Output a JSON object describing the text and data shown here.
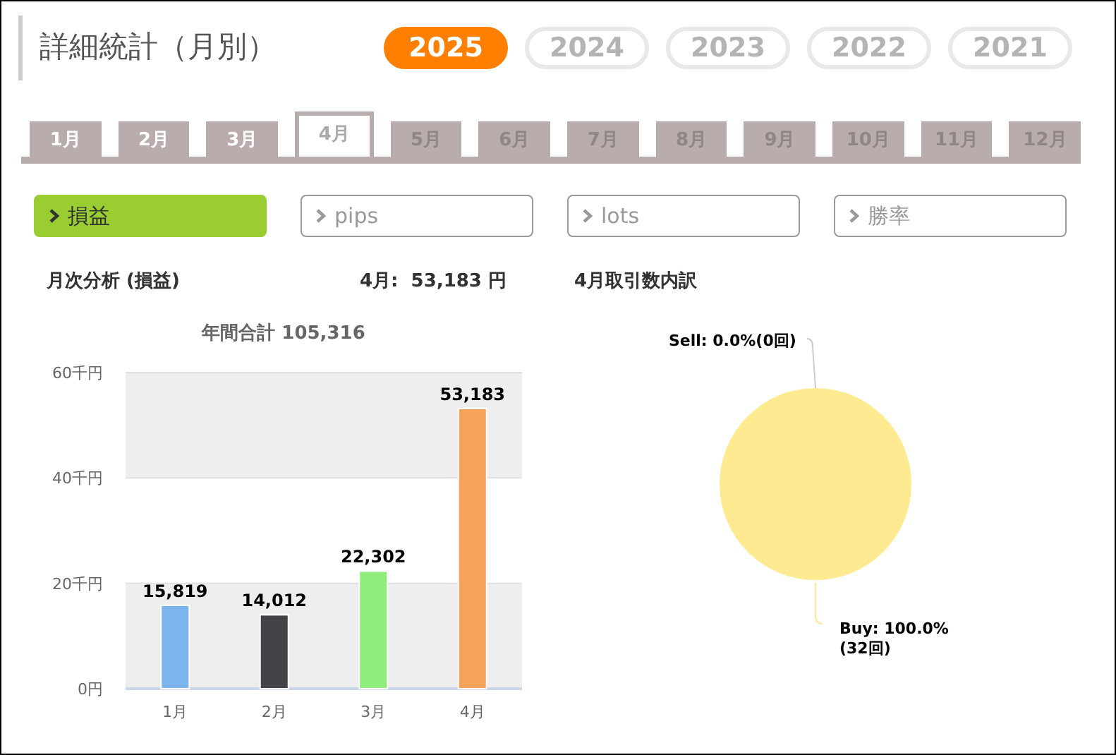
{
  "title": "詳細統計（月別）",
  "years": [
    {
      "label": "2025",
      "selected": true
    },
    {
      "label": "2024",
      "selected": false
    },
    {
      "label": "2023",
      "selected": false
    },
    {
      "label": "2022",
      "selected": false
    },
    {
      "label": "2021",
      "selected": false
    }
  ],
  "month_tabs": [
    {
      "label": "1月",
      "selected": false,
      "disabled": false
    },
    {
      "label": "2月",
      "selected": false,
      "disabled": false
    },
    {
      "label": "3月",
      "selected": false,
      "disabled": false
    },
    {
      "label": "4月",
      "selected": true,
      "disabled": false
    },
    {
      "label": "5月",
      "selected": false,
      "disabled": true
    },
    {
      "label": "6月",
      "selected": false,
      "disabled": true
    },
    {
      "label": "7月",
      "selected": false,
      "disabled": true
    },
    {
      "label": "8月",
      "selected": false,
      "disabled": true
    },
    {
      "label": "9月",
      "selected": false,
      "disabled": true
    },
    {
      "label": "10月",
      "selected": false,
      "disabled": true
    },
    {
      "label": "11月",
      "selected": false,
      "disabled": true
    },
    {
      "label": "12月",
      "selected": false,
      "disabled": true
    }
  ],
  "metrics": [
    {
      "label": "損益",
      "selected": true
    },
    {
      "label": "pips",
      "selected": false
    },
    {
      "label": "lots",
      "selected": false
    },
    {
      "label": "勝率",
      "selected": false
    }
  ],
  "monthly_analysis": {
    "heading": "月次分析 (損益)",
    "summary": "4月:  53,183 円",
    "chart_data": {
      "type": "bar",
      "title": "年間合計 105,316",
      "categories": [
        "1月",
        "2月",
        "3月",
        "4月"
      ],
      "series": [
        {
          "values": [
            15.819,
            14.012,
            22.302,
            53.183
          ]
        }
      ],
      "colors": [
        "#7cb5ec",
        "#434348",
        "#90ed7d",
        "#f7a35c"
      ],
      "ylim": [
        0,
        60
      ],
      "yticks": [
        {
          "value": 0,
          "label": "0円"
        },
        {
          "value": 20,
          "label": "20千円"
        },
        {
          "value": 40,
          "label": "40千円"
        },
        {
          "value": 60,
          "label": "60千円"
        }
      ],
      "value_labels": [
        "15,819",
        "14,012",
        "22,302",
        "53,183"
      ]
    }
  },
  "trade_breakdown": {
    "heading": "4月取引数内訳",
    "chart_data": {
      "type": "pie",
      "values": [
        0,
        100
      ],
      "colors": [
        "#cccccc",
        "#feeb91"
      ],
      "value_labels": [
        "Sell: 0.0%(0回)",
        "Buy: 100.0%(32回)"
      ]
    }
  }
}
